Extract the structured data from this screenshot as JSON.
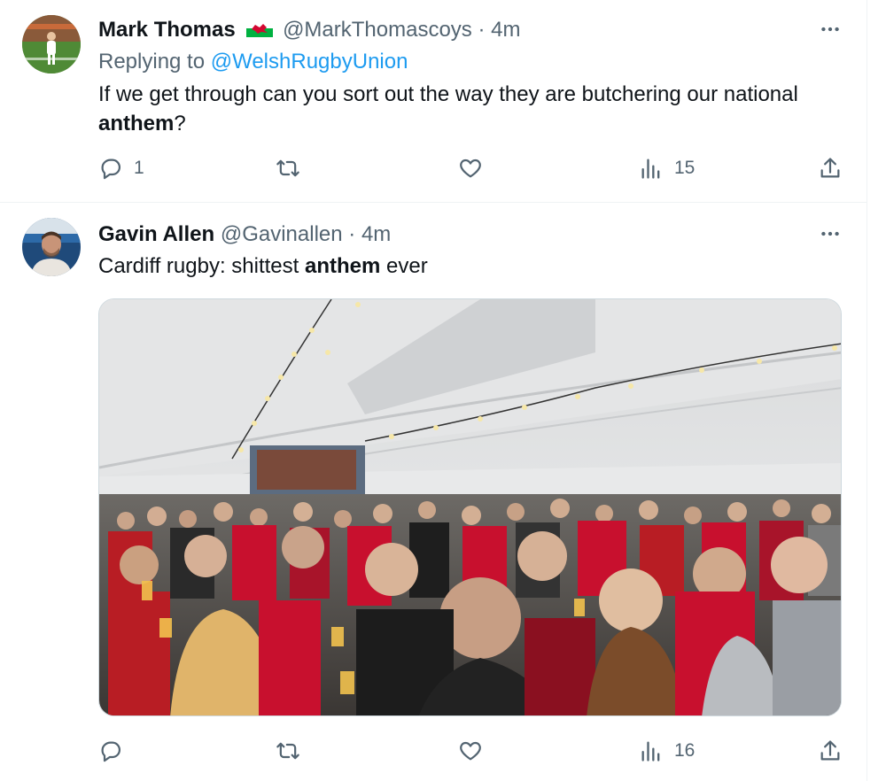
{
  "tweets": [
    {
      "display_name": "Mark Thomas",
      "flag": "🏴",
      "handle": "@MarkThomascoys",
      "separator": "·",
      "time": "4m",
      "reply_prefix": "Replying to",
      "reply_to": "@WelshRugbyUnion",
      "text_before": "If we get through can you sort out the way they are butchering our national",
      "text_bold": "anthem",
      "text_after": "?",
      "replies": "1",
      "retweets": "",
      "likes": "",
      "views": "15"
    },
    {
      "display_name": "Gavin Allen",
      "handle": "@Gavinallen",
      "separator": "·",
      "time": "4m",
      "text_before": "Cardiff rugby: shittest",
      "text_bold": "anthem",
      "text_after": "ever",
      "replies": "",
      "retweets": "",
      "likes": "",
      "views": "16"
    }
  ],
  "colors": {
    "text": "#0f1419",
    "secondary": "#536471",
    "link": "#1d9bf0",
    "divider": "#eff3f4",
    "welsh_red": "#c8102e"
  },
  "icons": [
    "more-icon",
    "reply-icon",
    "retweet-icon",
    "like-icon",
    "views-icon",
    "share-icon",
    "wales-flag-icon"
  ]
}
